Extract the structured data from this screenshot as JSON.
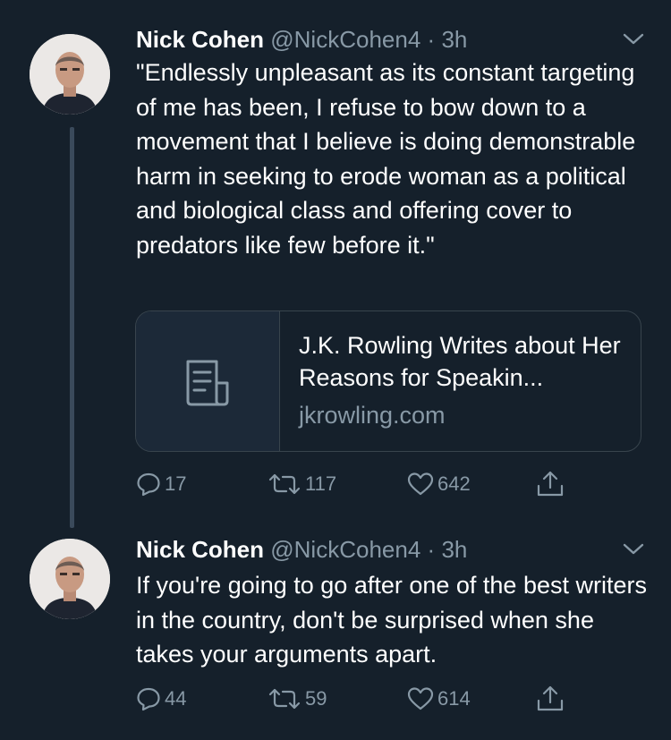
{
  "tweets": [
    {
      "name": "Nick Cohen",
      "handle": "@NickCohen4",
      "separator": "·",
      "time": "3h",
      "text": "\"Endlessly unpleasant as its constant targeting of me has been, I refuse to bow down to a movement that I believe is doing demonstrable harm in seeking to erode woman as a political and biological class and offering cover to predators like few before it.\"",
      "link_card": {
        "title": "J.K. Rowling Writes about Her Reasons for Speakin...",
        "domain": "jkrowling.com",
        "icon": "document-icon"
      },
      "replies": "17",
      "retweets": "117",
      "likes": "642"
    },
    {
      "name": "Nick Cohen",
      "handle": "@NickCohen4",
      "separator": "·",
      "time": "3h",
      "text": "If you're going to go after one of the best writers in the country, don't be surprised when she takes your arguments apart.",
      "replies": "44",
      "retweets": "59",
      "likes": "614"
    }
  ],
  "colors": {
    "background": "#15202b",
    "secondary_text": "#8899a6",
    "border": "#38444d",
    "thread_line": "#3a4a5b"
  }
}
